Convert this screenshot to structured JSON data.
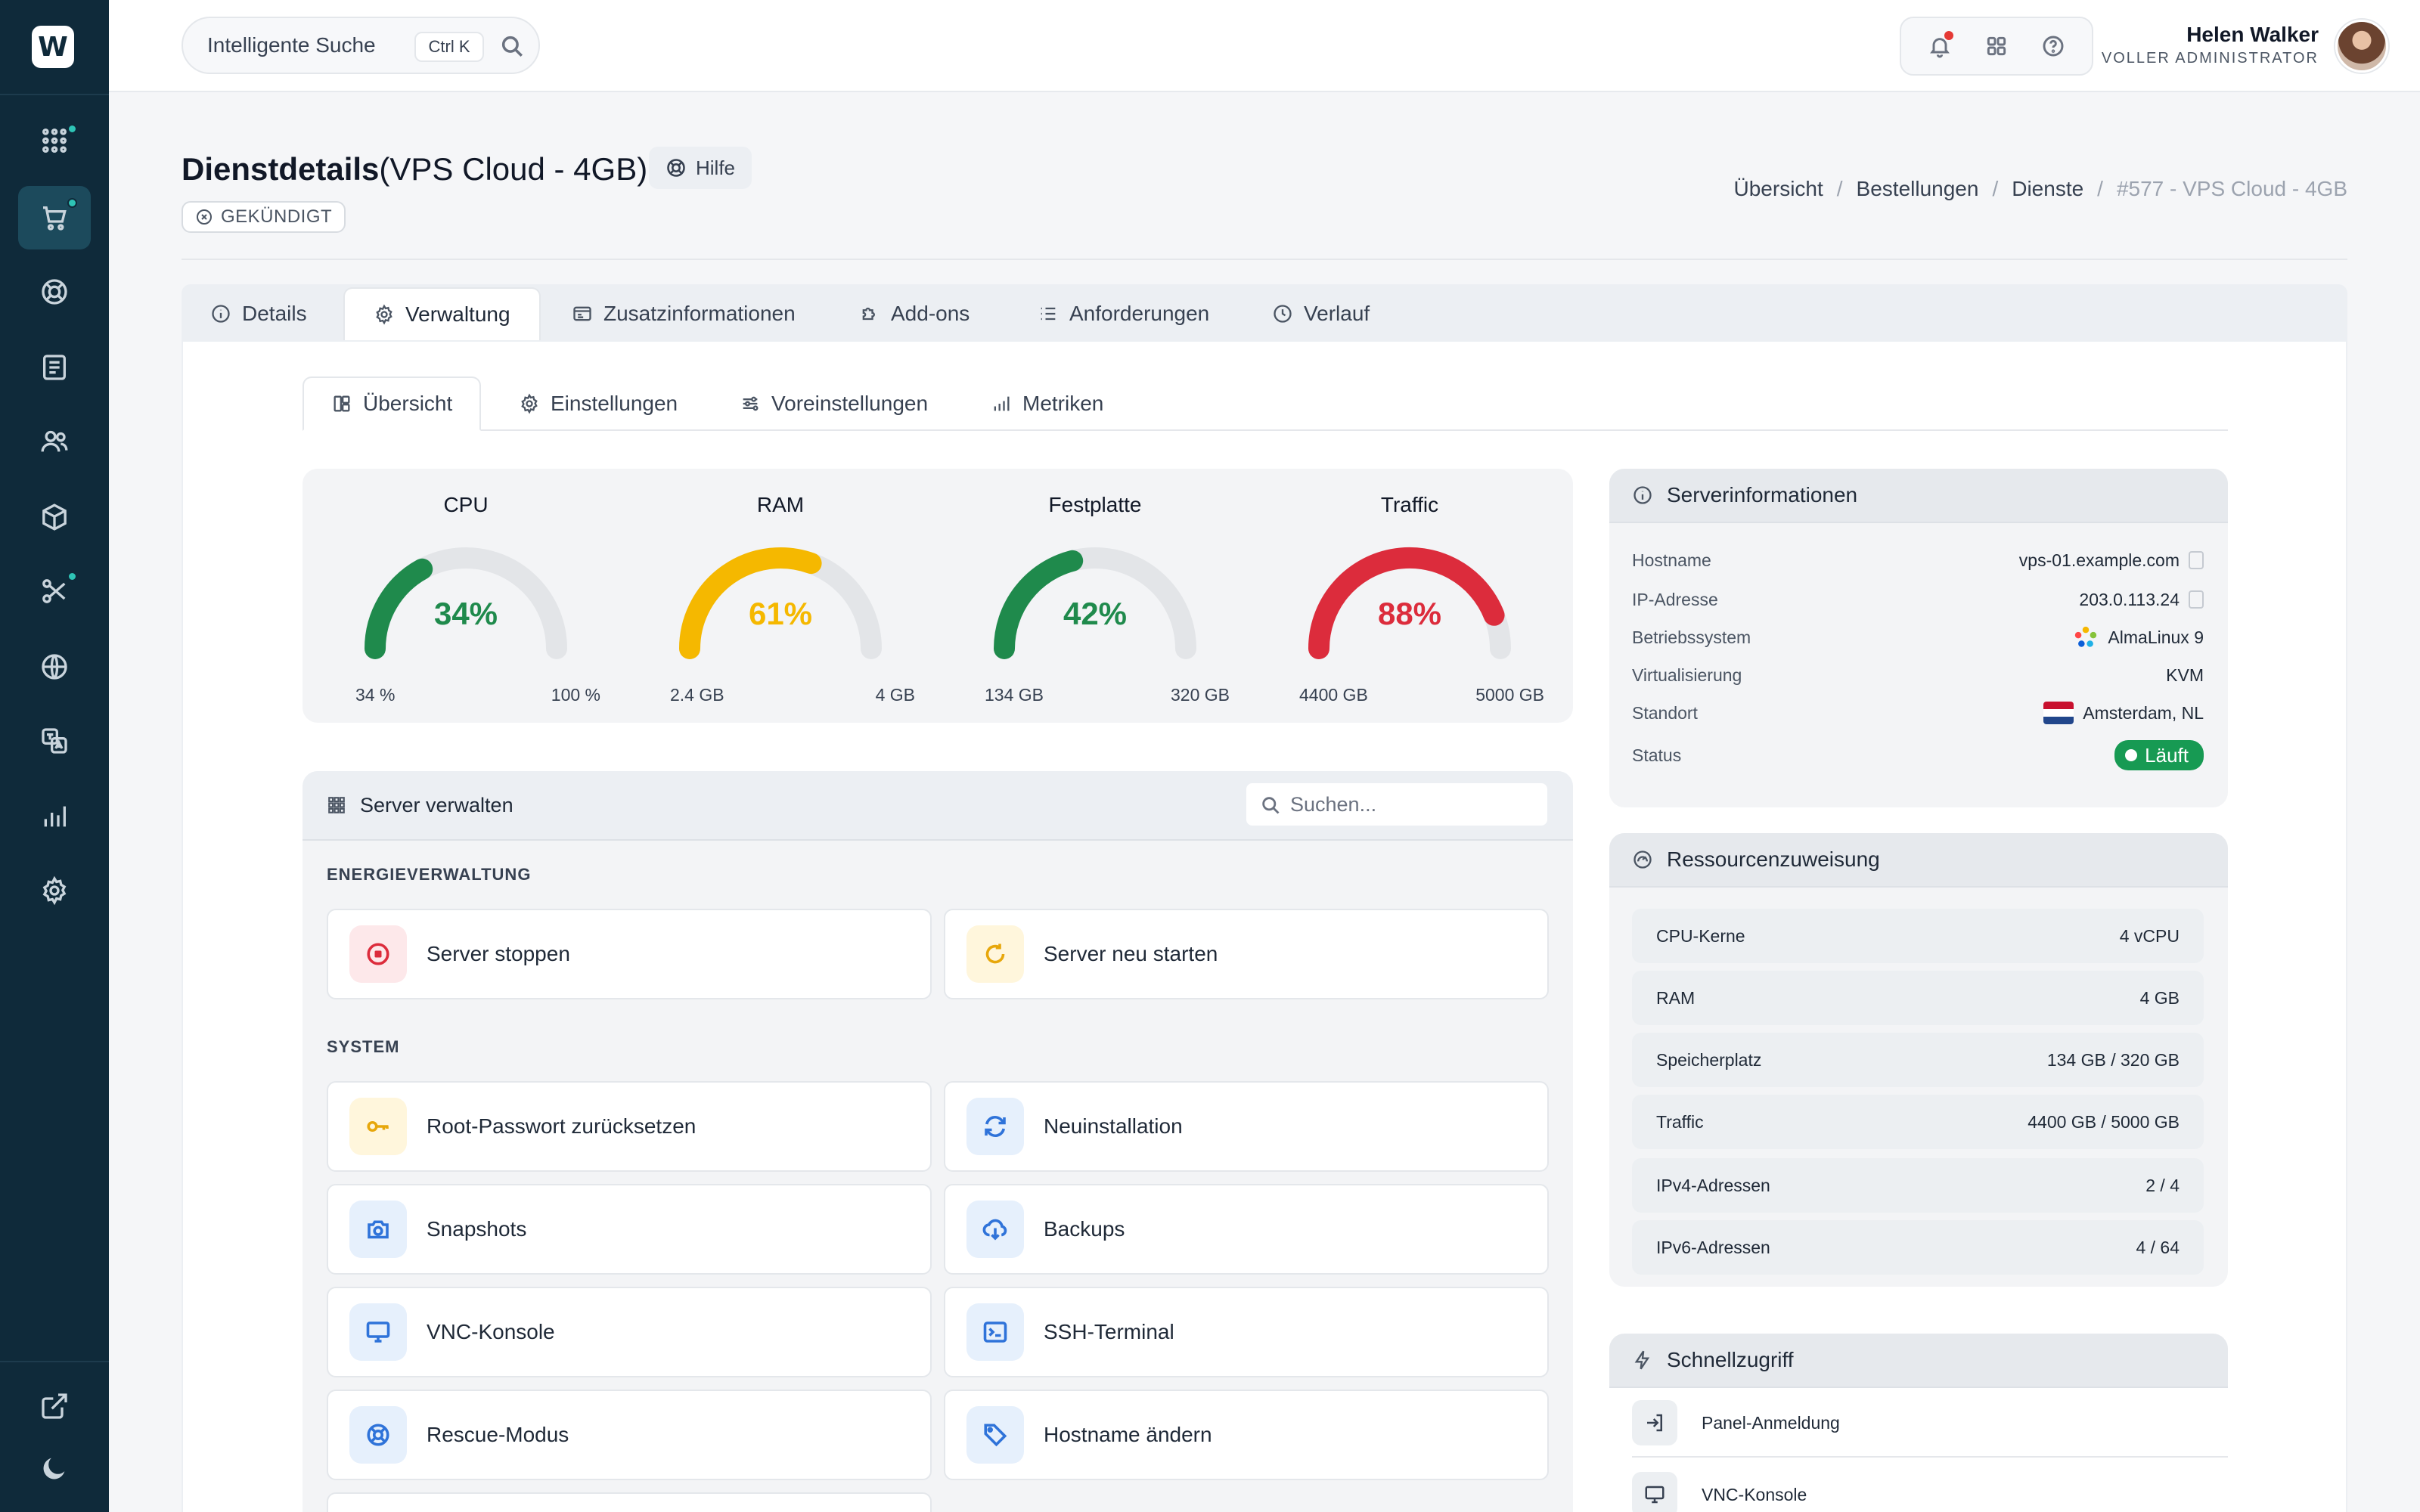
{
  "app": {
    "logo_letter": "W"
  },
  "search": {
    "placeholder": "Intelligente Suche",
    "shortcut": "Ctrl K"
  },
  "user": {
    "name": "Helen Walker",
    "role": "VOLLER ADMINISTRATOR"
  },
  "page": {
    "title_bold": "Dienstdetails",
    "title_rest": "(VPS Cloud - 4GB)",
    "help_label": "Hilfe",
    "status_label": "GEKÜNDIGT"
  },
  "breadcrumb": [
    "Übersicht",
    "Bestellungen",
    "Dienste",
    "#577 - VPS Cloud - 4GB"
  ],
  "tabs": [
    "Details",
    "Verwaltung",
    "Zusatzinformationen",
    "Add-ons",
    "Anforderungen",
    "Verlauf"
  ],
  "subtabs": [
    "Übersicht",
    "Einstellungen",
    "Voreinstellungen",
    "Metriken"
  ],
  "gauges": [
    {
      "title": "CPU",
      "percent": 34,
      "value_text": "34%",
      "min_label": "34 %",
      "max_label": "100 %",
      "color": "#1f8a4c"
    },
    {
      "title": "RAM",
      "percent": 61,
      "value_text": "61%",
      "min_label": "2.4 GB",
      "max_label": "4 GB",
      "color": "#f5b800"
    },
    {
      "title": "Festplatte",
      "percent": 42,
      "value_text": "42%",
      "min_label": "134 GB",
      "max_label": "320 GB",
      "color": "#1f8a4c"
    },
    {
      "title": "Traffic",
      "percent": 88,
      "value_text": "88%",
      "min_label": "4400 GB",
      "max_label": "5000 GB",
      "color": "#dc2c3c"
    }
  ],
  "manage": {
    "title": "Server verwalten",
    "search_placeholder": "Suchen...",
    "section_power": "ENERGIEVERWALTUNG",
    "section_system": "SYSTEM",
    "power_actions": [
      "Server stoppen",
      "Server neu starten"
    ],
    "system_actions": [
      "Root-Passwort zurücksetzen",
      "Neuinstallation",
      "Snapshots",
      "Backups",
      "VNC-Konsole",
      "SSH-Terminal",
      "Rescue-Modus",
      "Hostname ändern"
    ]
  },
  "server_info": {
    "title": "Serverinformationen",
    "rows": [
      {
        "k": "Hostname",
        "v": "vps-01.example.com"
      },
      {
        "k": "IP-Adresse",
        "v": "203.0.113.24"
      },
      {
        "k": "Betriebssystem",
        "v": "AlmaLinux 9"
      },
      {
        "k": "Virtualisierung",
        "v": "KVM"
      },
      {
        "k": "Standort",
        "v": "Amsterdam, NL"
      },
      {
        "k": "Status",
        "v": "Läuft"
      }
    ],
    "status_color": "#179a53"
  },
  "resources": {
    "title": "Ressourcenzuweisung",
    "rows": [
      {
        "k": "CPU-Kerne",
        "v": "4 vCPU"
      },
      {
        "k": "RAM",
        "v": "4 GB"
      },
      {
        "k": "Speicherplatz",
        "v": "134 GB / 320 GB"
      },
      {
        "k": "Traffic",
        "v": "4400 GB / 5000 GB"
      },
      {
        "k": "IPv4-Adressen",
        "v": "2 / 4"
      },
      {
        "k": "IPv6-Adressen",
        "v": "4 / 64"
      }
    ]
  },
  "quick": {
    "title": "Schnellzugriff",
    "items": [
      "Panel-Anmeldung",
      "VNC-Konsole"
    ]
  }
}
